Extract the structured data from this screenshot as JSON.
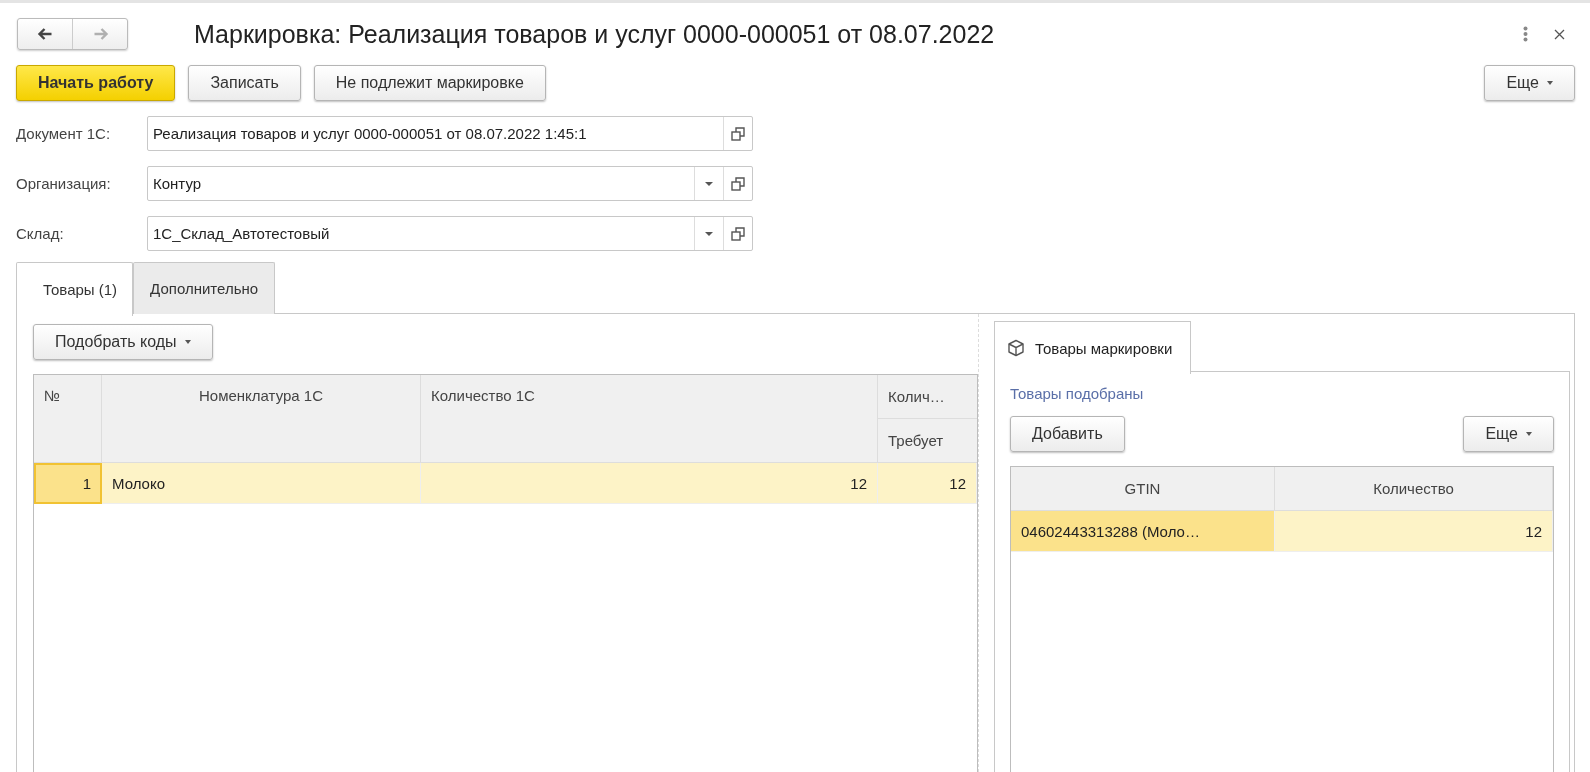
{
  "window": {
    "title": "Маркировка: Реализация товаров и услуг 0000-000051 от 08.07.2022",
    "nav": [
      {
        "kind": "back",
        "disabled": false
      },
      {
        "kind": "forward",
        "disabled": true
      }
    ]
  },
  "toolbar": {
    "buttons": [
      {
        "label": "Начать работу",
        "kind": "primary"
      },
      {
        "label": "Записать",
        "kind": "normal"
      },
      {
        "label": "Не подлежит маркировке",
        "kind": "normal"
      }
    ],
    "more": "Еще"
  },
  "fields": [
    {
      "label": "Документ 1С:",
      "value": "Реализация товаров и услуг 0000-000051 от 08.07.2022 1:45:1",
      "dropdown": false
    },
    {
      "label": "Организация:",
      "value": "Контур",
      "dropdown": true
    },
    {
      "label": "Склад:",
      "value": "1С_Склад_Автотестовый",
      "dropdown": true
    }
  ],
  "tabs": [
    {
      "label": "Товары (1)",
      "selected": true
    },
    {
      "label": "Дополнительно",
      "selected": false
    }
  ],
  "goods": {
    "pick_button": "Подобрать коды",
    "table": {
      "columns": [
        {
          "label": "№",
          "numeric": true
        },
        {
          "label": "Номенклатура 1С",
          "numeric": false
        },
        {
          "label": "Количество 1С",
          "numeric": true
        },
        {
          "label": "Колич…",
          "sublabel": "Требует",
          "numeric": true
        }
      ],
      "rows": [
        {
          "selected": true,
          "cells": [
            {
              "text": "1",
              "current": true
            },
            {
              "text": "Молоко",
              "current": false
            },
            {
              "text": "12",
              "current": false
            },
            {
              "text": "12",
              "current": false
            }
          ]
        }
      ]
    }
  },
  "marking": {
    "tab": {
      "label": "Товары маркировки",
      "selected": true
    },
    "status": "Товары подобраны",
    "add_button": "Добавить",
    "more": "Еще",
    "table": {
      "columns": [
        {
          "label": "GTIN",
          "numeric": false
        },
        {
          "label": "Количество",
          "numeric": true
        }
      ],
      "rows": [
        {
          "selected": true,
          "cells": [
            {
              "text": "04602443313288 (Моло…",
              "current": true
            },
            {
              "text": "12",
              "current": false
            }
          ]
        }
      ]
    }
  }
}
